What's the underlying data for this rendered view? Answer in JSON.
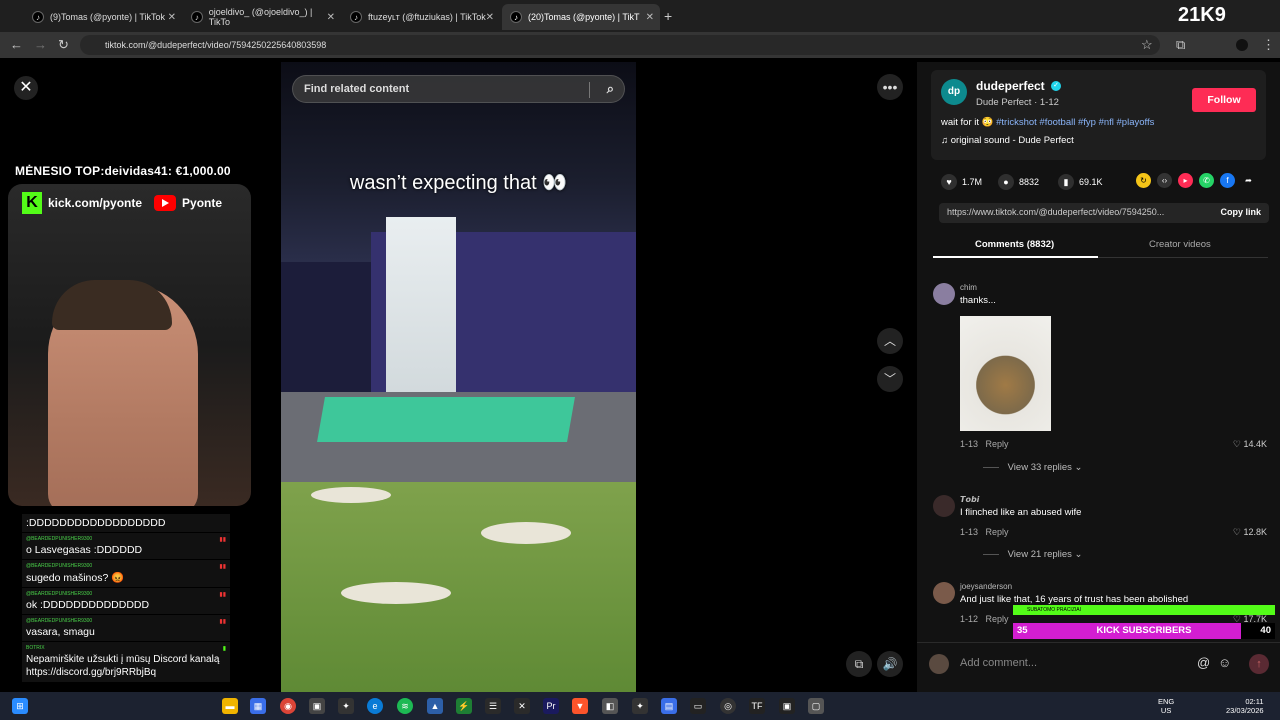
{
  "browser": {
    "tabs": [
      {
        "title": "(9)Tomas (@pyonte) | TikTok"
      },
      {
        "title": "ojoeldivo_ (@ojoeldivo_) | TikTo"
      },
      {
        "title": "ftuzeyʟᴛ (@ftuziukas) | TikTok"
      },
      {
        "title": "(20)Tomas (@pyonte) | TikT"
      }
    ],
    "url": "tiktok.com/@dudeperfect/video/7594250225640803598"
  },
  "overlay": {
    "stream_logo": "21K9",
    "top_donor": "MĖNESIO TOP:deividas41: €1,000.00",
    "kick_url": "kick.com/pyonte",
    "youtube_name": "Pyonte"
  },
  "chat": [
    {
      "user": "",
      "text": ":DDDDDDDDDDDDDDDDDD"
    },
    {
      "user": "@BEARDEDPUNISHER9300",
      "text": "o Lasvegasas :DDDDDD"
    },
    {
      "user": "@BEARDEDPUNISHER9300",
      "text": "sugedo mašinos? 😡"
    },
    {
      "user": "@BEARDEDPUNISHER9300",
      "text": "ok :DDDDDDDDDDDDDD"
    },
    {
      "user": "@BEARDEDPUNISHER9300",
      "text": "vasara, smagu"
    },
    {
      "user": "BOTRIX",
      "text": "Nepamirškite užsukti į mūsų Discord kanalą https://discord.gg/brj9RRbjBq"
    }
  ],
  "video": {
    "search_placeholder": "Find related content",
    "caption": "wasn’t expecting that 👀"
  },
  "author": {
    "name": "dudeperfect",
    "avatar_text": "dp",
    "sub": "Dude Perfect · 1-12",
    "follow_label": "Follow",
    "desc_text": "wait for it 😳",
    "desc_tags": "#trickshot #football #fyp #nfl #playoffs",
    "sound": "original sound - Dude Perfect"
  },
  "stats": {
    "likes": "1.7M",
    "comments": "8832",
    "saves": "69.1K"
  },
  "link": {
    "url": "https://www.tiktok.com/@dudeperfect/video/7594250...",
    "copy_label": "Copy link"
  },
  "tabs": {
    "comments": "Comments (8832)",
    "creator": "Creator videos"
  },
  "comments": [
    {
      "user": "chim",
      "text": "thanks...",
      "date": "1-13",
      "reply": "Reply",
      "likes": "14.4K",
      "replies": "View 33 replies"
    },
    {
      "user": "𝙏𝙤𝙗𝙞",
      "text": "I flinched like an abused wife",
      "date": "1-13",
      "reply": "Reply",
      "likes": "12.8K",
      "replies": "View 21 replies"
    },
    {
      "user": "joeysanderson",
      "text": "And just like that, 16 years of trust has been abolished",
      "date": "1-12",
      "reply": "Reply",
      "likes": "17.7K"
    }
  ],
  "subs": {
    "top_text": "SUBATOMO PRACIZIAI",
    "left": "35",
    "label": "KICK SUBSCRIBERS",
    "right": "40"
  },
  "add_comment": {
    "placeholder": "Add comment..."
  },
  "taskbar": {
    "lang_top": "ENG",
    "lang_bottom": "US",
    "time": "02:11",
    "date": "23/03/2026"
  },
  "colors": {
    "follow": "#fe2c55",
    "kick_green": "#53fc18",
    "sub_bar": "#d31ed1",
    "hashtag": "#8ab4f8"
  }
}
